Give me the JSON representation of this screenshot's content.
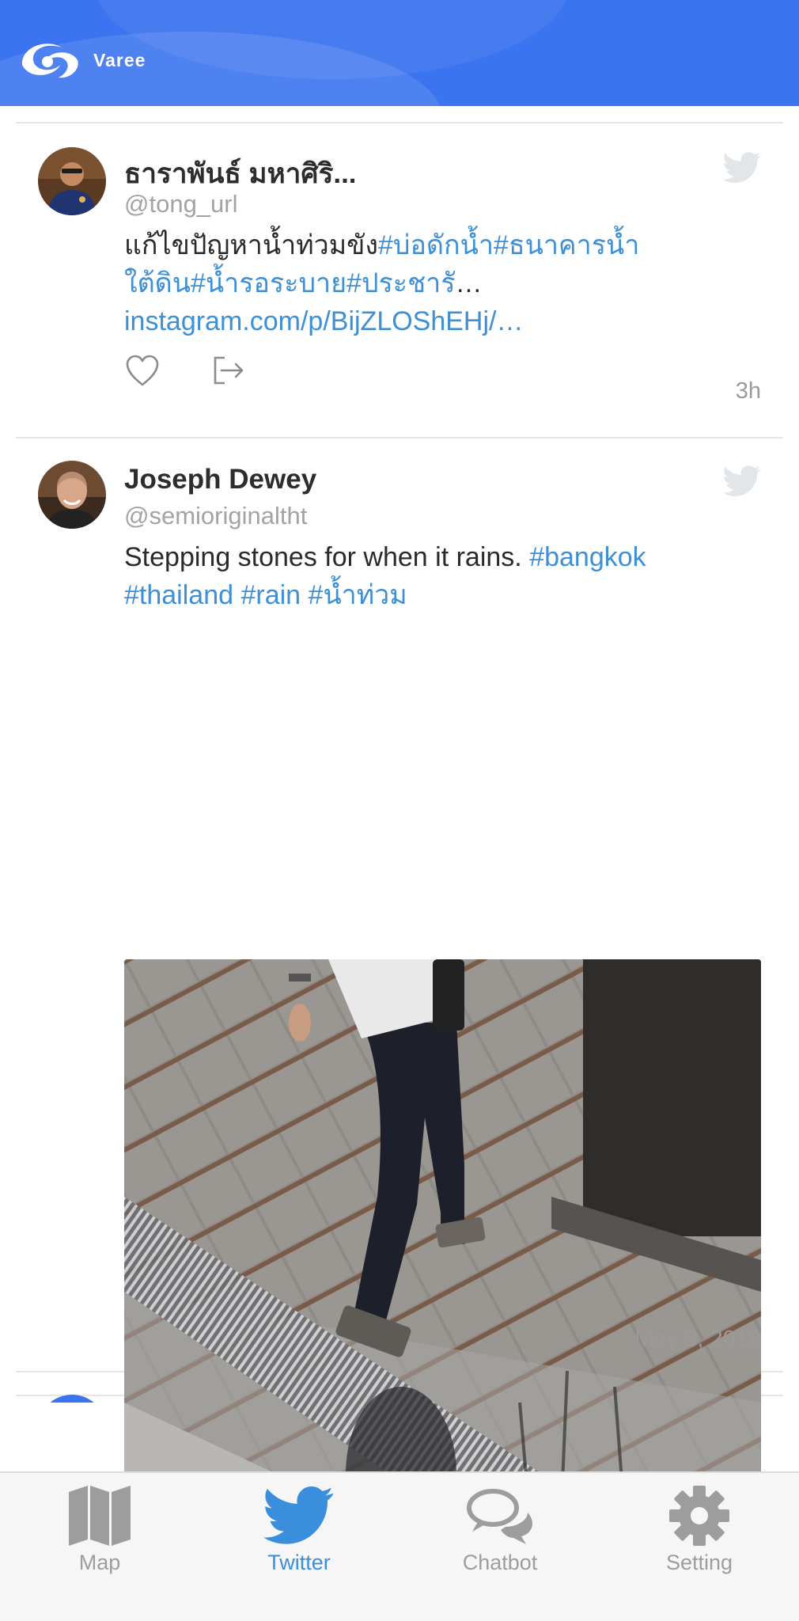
{
  "header": {
    "brand": "Varee"
  },
  "tweets": [
    {
      "name": "ธาราพันธ์ มหาศิริ...",
      "handle": "@tong_url",
      "text_plain": "แก้ไขปัญหาน้ำท่วมขัง",
      "text_tags_line1": "#บ่อดักน้ำ#ธนาคารน้ำ",
      "text_tags_line2": "ใต้ดิน#น้ำรอระบาย#ประชารั",
      "text_ellipsis": "…",
      "link": "instagram.com/p/BijZLOShEHj/…",
      "time": "3h"
    },
    {
      "name": "Joseph Dewey",
      "handle": "@semioriginaltht",
      "text_plain": "Stepping stones for when it rains.",
      "tag1": "#bangkok",
      "tag2": "#thailand",
      "tag3": "#rain",
      "tag4": "#น้ำท่วม",
      "time": "May 8, 2018"
    }
  ],
  "tabs": [
    {
      "label": "Map",
      "icon": "map-icon",
      "active": false
    },
    {
      "label": "Twitter",
      "icon": "twitter-bird-icon",
      "active": true
    },
    {
      "label": "Chatbot",
      "icon": "chat-bubbles-icon",
      "active": false
    },
    {
      "label": "Setting",
      "icon": "gear-icon",
      "active": false
    }
  ],
  "colors": {
    "header_bg": "#3b74f0",
    "link": "#3d8fd6",
    "tab_active": "#3b8edb",
    "tab_inactive": "#9d9d9d"
  }
}
